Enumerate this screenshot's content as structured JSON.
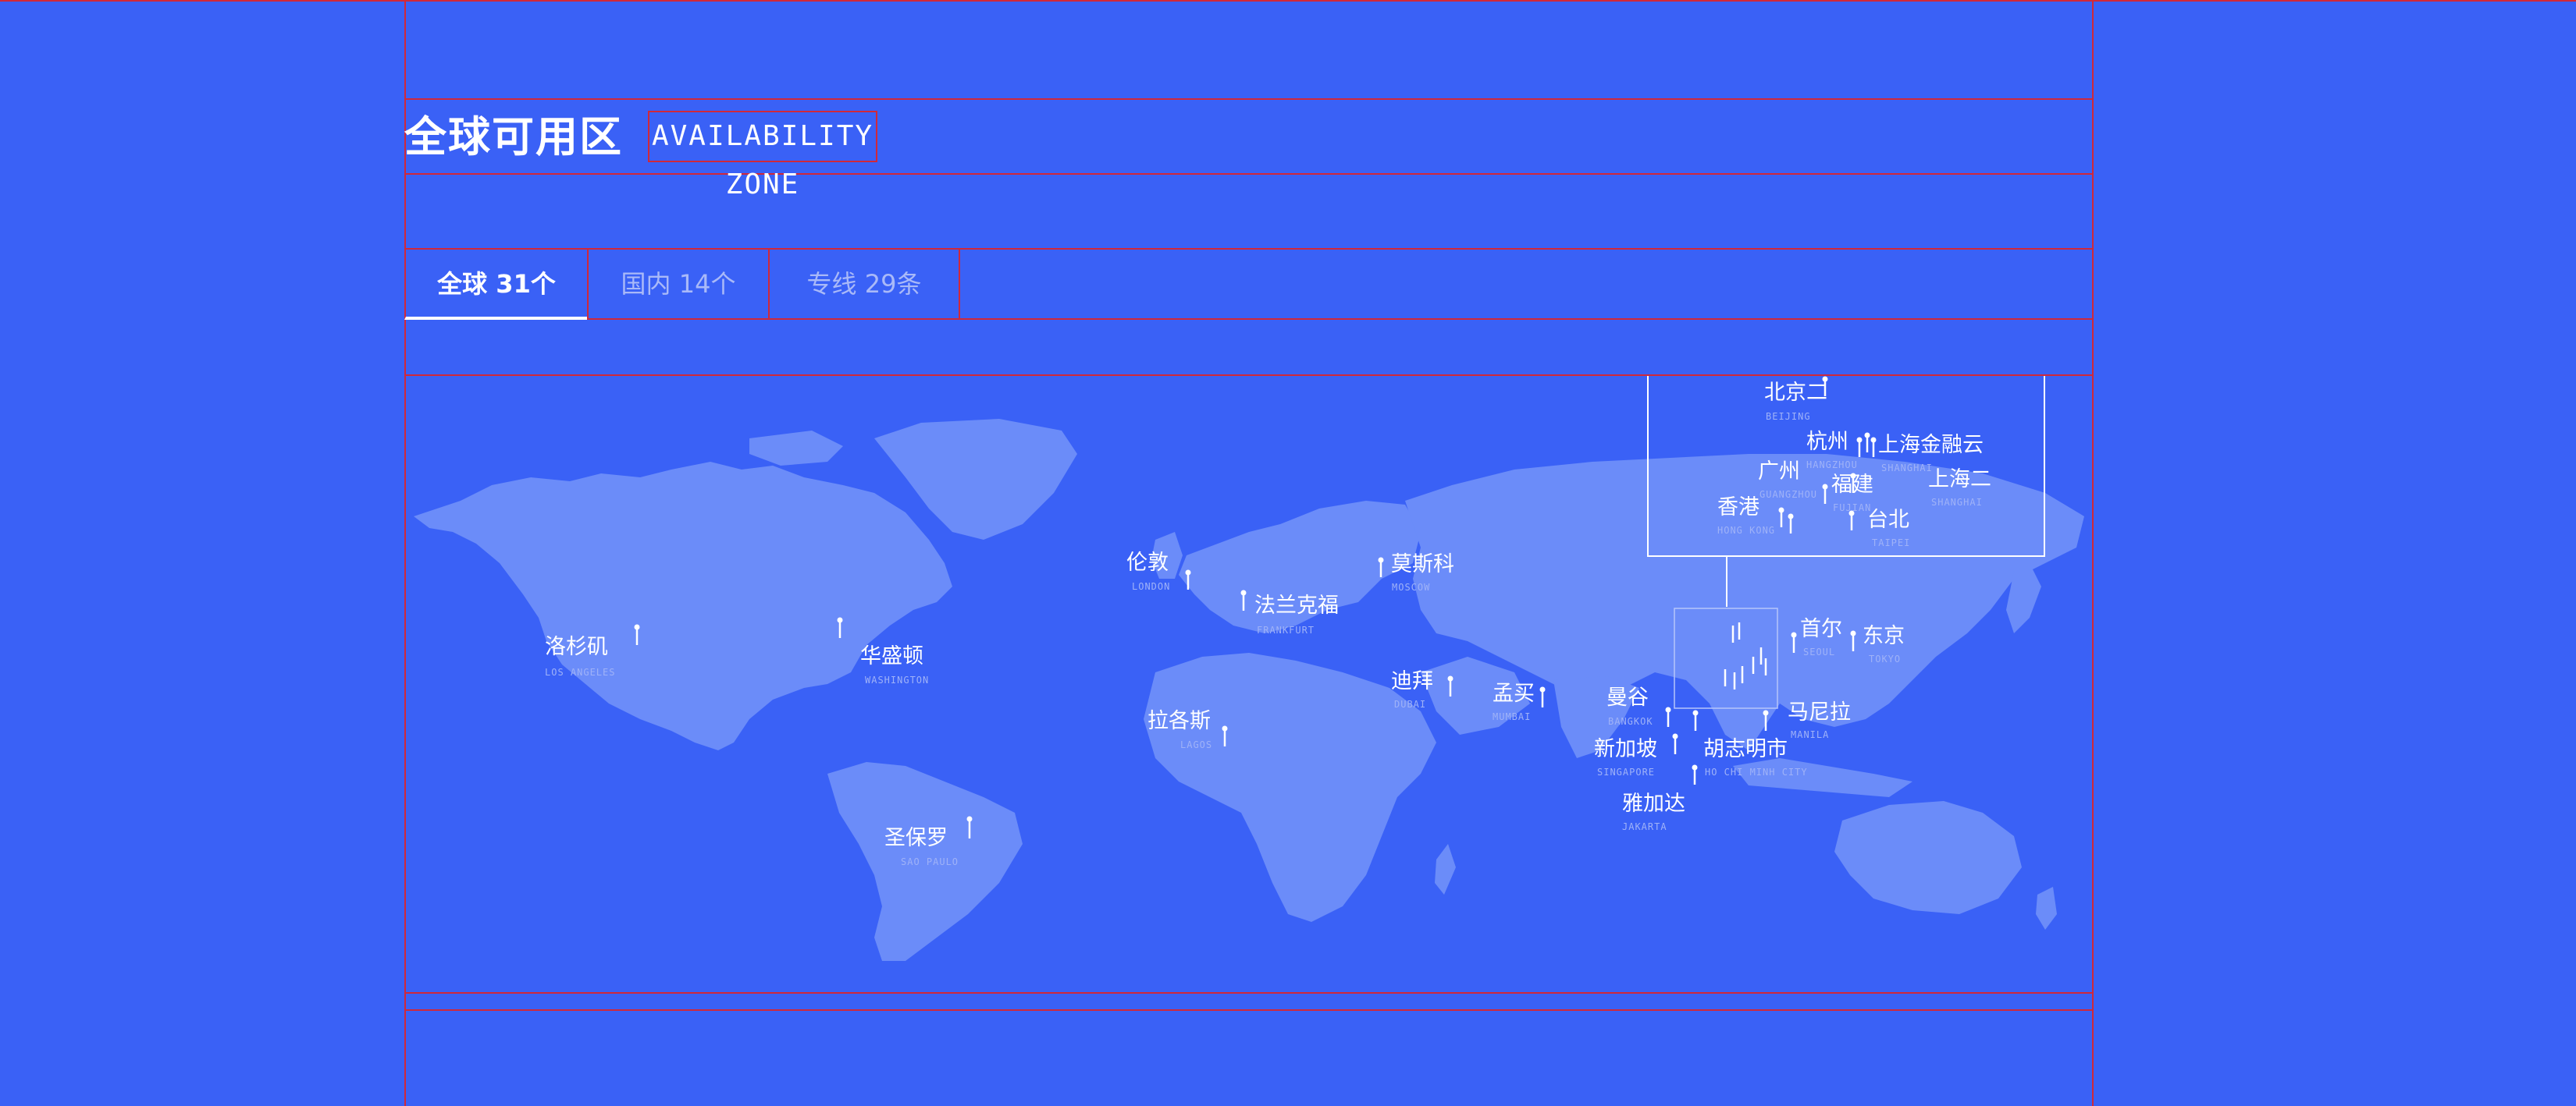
{
  "header": {
    "title": "全球可用区",
    "subtitle": "AVAILABILITY ZONE"
  },
  "tabs": [
    {
      "label": "全球 31个",
      "active": true
    },
    {
      "label": "国内 14个",
      "active": false
    },
    {
      "label": "专线 29条",
      "active": false
    }
  ],
  "map": {
    "cities": [
      {
        "id": "los-angeles",
        "name": "洛杉矶",
        "en": "LOS ANGELES"
      },
      {
        "id": "washington",
        "name": "华盛顿",
        "en": "WASHINGTON"
      },
      {
        "id": "sao-paulo",
        "name": "圣保罗",
        "en": "SAO PAULO"
      },
      {
        "id": "london",
        "name": "伦敦",
        "en": "LONDON"
      },
      {
        "id": "frankfurt",
        "name": "法兰克福",
        "en": "FRANKFURT"
      },
      {
        "id": "moscow",
        "name": "莫斯科",
        "en": "MOSCOW"
      },
      {
        "id": "lagos",
        "name": "拉各斯",
        "en": "LAGOS"
      },
      {
        "id": "dubai",
        "name": "迪拜",
        "en": "DUBAI"
      },
      {
        "id": "mumbai",
        "name": "孟买",
        "en": "MUMBAI"
      },
      {
        "id": "bangkok",
        "name": "曼谷",
        "en": "BANGKOK"
      },
      {
        "id": "singapore",
        "name": "新加坡",
        "en": "SINGAPORE"
      },
      {
        "id": "jakarta",
        "name": "雅加达",
        "en": "JAKARTA"
      },
      {
        "id": "ho-chi-minh",
        "name": "胡志明市",
        "en": "HO CHI MINH CITY"
      },
      {
        "id": "manila",
        "name": "马尼拉",
        "en": "MANILA"
      },
      {
        "id": "seoul",
        "name": "首尔",
        "en": "SEOUL"
      },
      {
        "id": "tokyo",
        "name": "东京",
        "en": "TOKYO"
      }
    ],
    "china_cities": [
      {
        "id": "beijing",
        "name": "北京二",
        "en": "BEIJING"
      },
      {
        "id": "hangzhou",
        "name": "杭州",
        "en": "HANGZHOU"
      },
      {
        "id": "shanghai-finance",
        "name": "上海金融云",
        "en": "SHANGHAI"
      },
      {
        "id": "guangzhou",
        "name": "广州",
        "en": "GUANGZHOU"
      },
      {
        "id": "fujian",
        "name": "福建",
        "en": "FUJIAN"
      },
      {
        "id": "shanghai-2",
        "name": "上海二",
        "en": "SHANGHAI"
      },
      {
        "id": "hong-kong",
        "name": "香港",
        "en": "HONG KONG"
      },
      {
        "id": "taipei",
        "name": "台北",
        "en": "TAIPEI"
      }
    ]
  },
  "colors": {
    "background": "#3a61f6",
    "land": "#6b8cf9",
    "guide": "#d0283a",
    "text": "#ffffff",
    "muted_text": "#a9b9f8"
  }
}
